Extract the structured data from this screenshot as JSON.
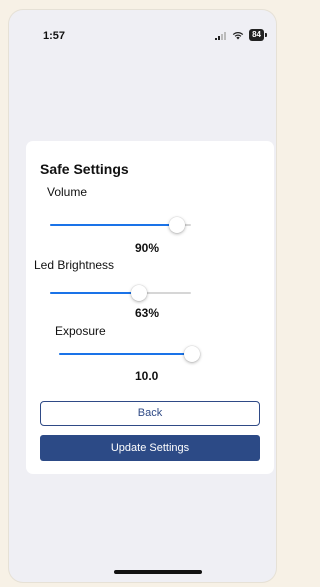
{
  "status_bar": {
    "time": "1:57",
    "battery": "84",
    "icons": [
      "signal-icon",
      "wifi-icon",
      "battery-icon"
    ]
  },
  "settings": {
    "title": "Safe Settings",
    "items": [
      {
        "label": "Volume",
        "value_text": "90%",
        "level": 0.9
      },
      {
        "label": "Led Brightness",
        "value_text": "63%",
        "level": 0.63
      },
      {
        "label": "Exposure",
        "value_text": "10.0",
        "level": 1.0
      }
    ]
  },
  "buttons": {
    "back_label": "Back",
    "update_label": "Update Settings"
  },
  "colors": {
    "accent": "#1a73e8",
    "primary_button": "#2c4a86",
    "background": "#efeff4"
  }
}
